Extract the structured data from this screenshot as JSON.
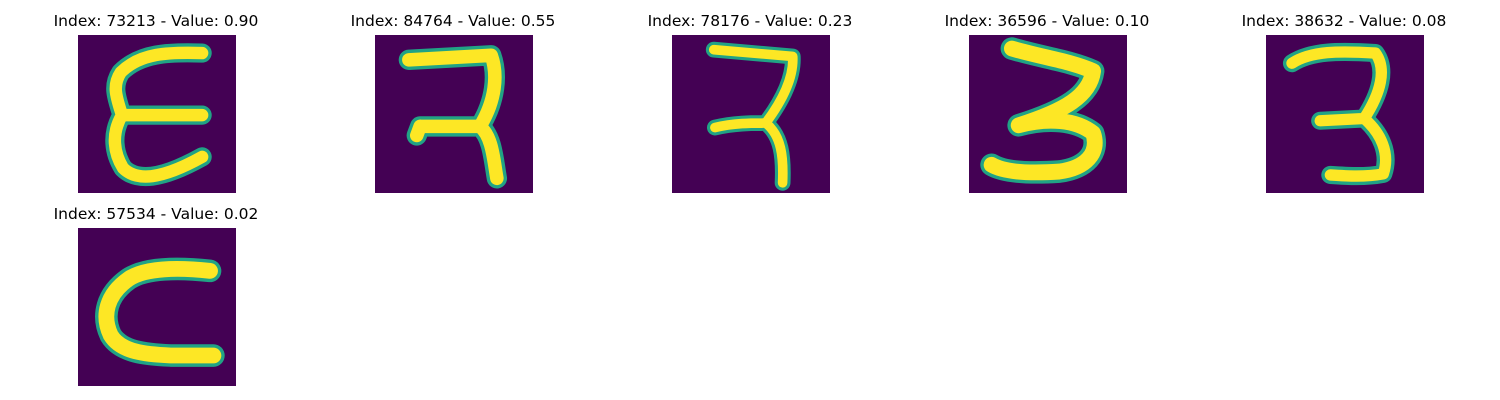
{
  "figure": {
    "background": "#ffffff",
    "image_background": "#440154",
    "colormap": "viridis",
    "panels": [
      {
        "title": "Index: 73213 - Value: 0.90",
        "glyph": "E"
      },
      {
        "title": "Index: 84764 - Value: 0.55",
        "glyph": "7"
      },
      {
        "title": "Index: 78176 - Value: 0.23",
        "glyph": "7"
      },
      {
        "title": "Index: 36596 - Value: 0.10",
        "glyph": "3"
      },
      {
        "title": "Index: 38632 - Value: 0.08",
        "glyph": "3"
      },
      {
        "title": "Index: 57534 - Value: 0.02",
        "glyph": "C"
      }
    ]
  }
}
